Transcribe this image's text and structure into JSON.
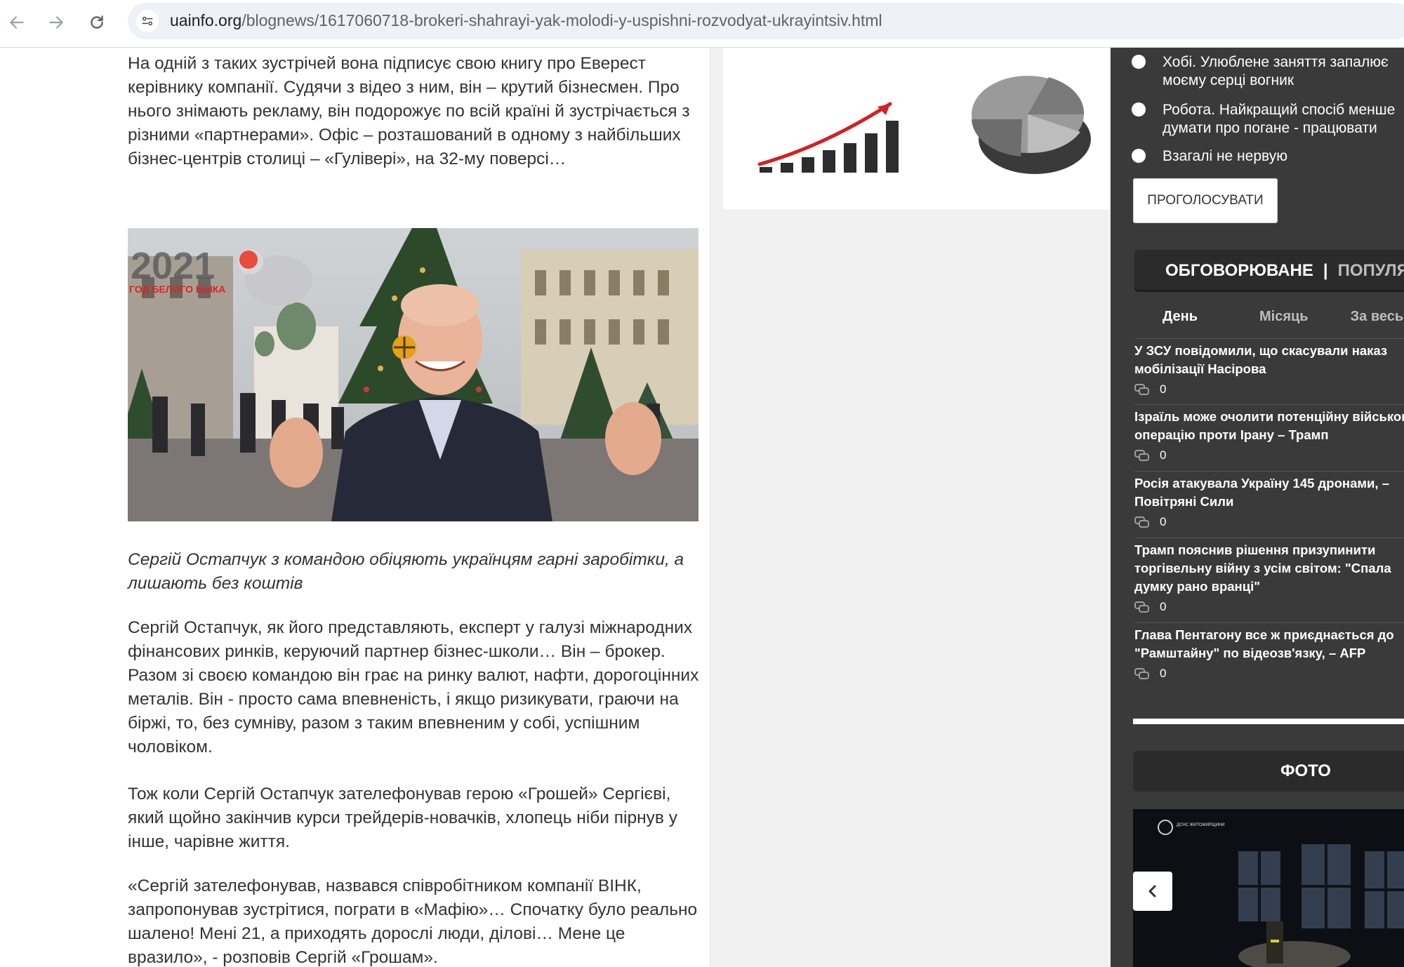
{
  "browser": {
    "url_host": "uainfo.org",
    "url_path": "/blognews/1617060718-brokeri-shahrayi-yak-molodi-y-uspishni-rozvodyat-ukrayintsiv.html"
  },
  "article": {
    "paragraphs": [
      "На одній з таких зустрічей вона підписує свою книгу про Еверест керівнику компанії. Судячи з відео з ним, він – крутий бізнесмен. Про нього знімають рекламу, він подорожує по всій країні й зустрічається з різними «партнерами». Офіс – розташований в одному з найбільших бізнес-центрів столиці – «Гуліверi», на 32-му поверсі…",
      "Сергій Остапчук, як його представляють, експерт у галузі міжнародних фінансових ринків, керуючий партнер бізнес-школи… Він – брокер. Разом зі своєю командою він грає на ринку валют, нафти, дорогоцінних металів. Він - просто сама впевненість, і якщо ризикувати, граючи на біржі, то, без сумніву, разом з таким впевненим у собі, успішним чоловіком.",
      "Тож коли Сергій Остапчук зателефонував герою «Грошей» Сергієві, який щойно закінчив курси трейдерів-новачків, хлопець ніби пірнув у інше, чарівне життя.",
      "«Сергій зателефонував, назвався співробітником компанії ВІНК, запропонував зустрітися, пограти в «Мафію»… Спочатку було реально шалено! Мені 21, а приходять дорослі люди, ділові… Мене це вразило», - розповів Сергій «Грошам»."
    ],
    "photo_overlay": {
      "year": "2021",
      "subtitle": "ГОД БЕЛОГО БЫКА"
    },
    "caption": "Сергій Остапчук з командою обіцяють українцям гарні заробітки, а лишають без коштів"
  },
  "sidebar": {
    "poll": {
      "options": [
        {
          "line1": "Хобі. Улюблене заняття запалює",
          "line2": "моєму серці вогник"
        },
        {
          "line1": "Робота. Найкращий спосіб менше",
          "line2": "думати про погане - працювати"
        },
        {
          "line1": "Взагалі не нервую",
          "line2": ""
        }
      ],
      "vote_label": "ПРОГОЛОСУВАТИ"
    },
    "tabs": {
      "active": "ОБГОВОРЮВАНЕ",
      "separator": "|",
      "other": "ПОПУЛЯРНЕ"
    },
    "periods": [
      "День",
      "Місяць",
      "За весь час"
    ],
    "news": [
      {
        "title_lines": [
          "У ЗСУ повідомили, що скасували наказ",
          "мобілізації Насірова"
        ],
        "comments": "0"
      },
      {
        "title_lines": [
          "Ізраїль може очолити потенційну військову",
          "операцію проти Ірану – Трамп"
        ],
        "comments": "0"
      },
      {
        "title_lines": [
          "Росія атакувала Україну 145 дронами, –",
          "Повітряні Сили"
        ],
        "comments": "0"
      },
      {
        "title_lines": [
          "Трамп пояснив рішення призупинити",
          "торгівельну війну з усім світом: \"Спала",
          "думку рано вранці\""
        ],
        "comments": "0"
      },
      {
        "title_lines": [
          "Глава Пентагону все ж приєднається до",
          "\"Рамштайну\" по відеозв'язку, – AFP"
        ],
        "comments": "0"
      }
    ],
    "foto_label": "ФОТО",
    "foto_watermark": "ДСНС ЖИТОМИРЩИНИ"
  }
}
